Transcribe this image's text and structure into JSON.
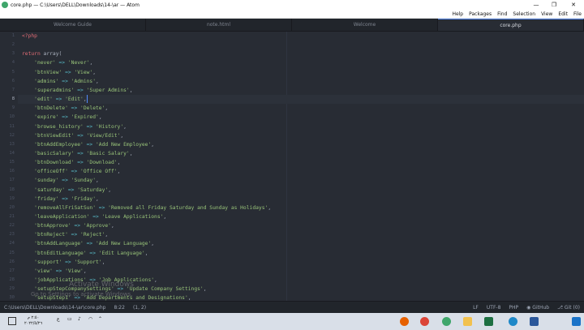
{
  "window": {
    "title": "core.php — C:\\Users\\DELL\\Downloads\\14-\\ar — Atom",
    "minimize": "—",
    "maximize": "❐",
    "close": "✕"
  },
  "menu": [
    "Help",
    "Packages",
    "Find",
    "Selection",
    "View",
    "Edit",
    "File"
  ],
  "tabs": [
    "Welcome Guide",
    "note.html",
    "Welcome",
    "core.php"
  ],
  "editor": {
    "current_line": 8,
    "lines": [
      {
        "n": "1",
        "parts": [
          {
            "c": "k",
            "t": "<?php"
          }
        ]
      },
      {
        "n": "2",
        "parts": []
      },
      {
        "n": "3",
        "parts": [
          {
            "c": "k",
            "t": "return"
          },
          {
            "c": "",
            "t": " array("
          }
        ]
      },
      {
        "n": "4",
        "parts": [
          {
            "c": "",
            "t": "    "
          },
          {
            "c": "s",
            "t": "'never'"
          },
          {
            "c": "o",
            "t": " => "
          },
          {
            "c": "s",
            "t": "'Never'"
          },
          {
            "c": "",
            "t": ","
          }
        ]
      },
      {
        "n": "5",
        "parts": [
          {
            "c": "",
            "t": "    "
          },
          {
            "c": "s",
            "t": "'btnView'"
          },
          {
            "c": "o",
            "t": " => "
          },
          {
            "c": "s",
            "t": "'View'"
          },
          {
            "c": "",
            "t": ","
          }
        ]
      },
      {
        "n": "6",
        "parts": [
          {
            "c": "",
            "t": "    "
          },
          {
            "c": "s",
            "t": "'admins'"
          },
          {
            "c": "o",
            "t": " => "
          },
          {
            "c": "s",
            "t": "'Admins'"
          },
          {
            "c": "",
            "t": ","
          }
        ]
      },
      {
        "n": "7",
        "parts": [
          {
            "c": "",
            "t": "    "
          },
          {
            "c": "s",
            "t": "'superadmins'"
          },
          {
            "c": "o",
            "t": " => "
          },
          {
            "c": "s",
            "t": "'Super Admins'"
          },
          {
            "c": "",
            "t": ","
          }
        ]
      },
      {
        "n": "8",
        "parts": [
          {
            "c": "",
            "t": "    "
          },
          {
            "c": "s",
            "t": "'edit'"
          },
          {
            "c": "o",
            "t": " => "
          },
          {
            "c": "s",
            "t": "'Edit'"
          },
          {
            "c": "",
            "t": ","
          }
        ]
      },
      {
        "n": "9",
        "parts": [
          {
            "c": "",
            "t": "    "
          },
          {
            "c": "s",
            "t": "'btnDelete'"
          },
          {
            "c": "o",
            "t": " => "
          },
          {
            "c": "s",
            "t": "'Delete'"
          },
          {
            "c": "",
            "t": ","
          }
        ]
      },
      {
        "n": "10",
        "parts": [
          {
            "c": "",
            "t": "    "
          },
          {
            "c": "s",
            "t": "'expire'"
          },
          {
            "c": "o",
            "t": " => "
          },
          {
            "c": "s",
            "t": "'Expired'"
          },
          {
            "c": "",
            "t": ","
          }
        ]
      },
      {
        "n": "11",
        "parts": [
          {
            "c": "",
            "t": "    "
          },
          {
            "c": "s",
            "t": "'browse_history'"
          },
          {
            "c": "o",
            "t": " => "
          },
          {
            "c": "s",
            "t": "'History'"
          },
          {
            "c": "",
            "t": ","
          }
        ]
      },
      {
        "n": "12",
        "parts": [
          {
            "c": "",
            "t": "    "
          },
          {
            "c": "s",
            "t": "'btnViewEdit'"
          },
          {
            "c": "o",
            "t": " => "
          },
          {
            "c": "s",
            "t": "'View/Edit'"
          },
          {
            "c": "",
            "t": ","
          }
        ]
      },
      {
        "n": "13",
        "parts": [
          {
            "c": "",
            "t": "    "
          },
          {
            "c": "s",
            "t": "'btnAddEmployee'"
          },
          {
            "c": "o",
            "t": " => "
          },
          {
            "c": "s",
            "t": "'Add New Employee'"
          },
          {
            "c": "",
            "t": ","
          }
        ]
      },
      {
        "n": "14",
        "parts": [
          {
            "c": "",
            "t": "    "
          },
          {
            "c": "s",
            "t": "'basicSalary'"
          },
          {
            "c": "o",
            "t": " => "
          },
          {
            "c": "s",
            "t": "'Basic Salary'"
          },
          {
            "c": "",
            "t": ","
          }
        ]
      },
      {
        "n": "15",
        "parts": [
          {
            "c": "",
            "t": "    "
          },
          {
            "c": "s",
            "t": "'btnDownload'"
          },
          {
            "c": "o",
            "t": " => "
          },
          {
            "c": "s",
            "t": "'Download'"
          },
          {
            "c": "",
            "t": ","
          }
        ]
      },
      {
        "n": "16",
        "parts": [
          {
            "c": "",
            "t": "    "
          },
          {
            "c": "s",
            "t": "'officeOff'"
          },
          {
            "c": "o",
            "t": " => "
          },
          {
            "c": "s",
            "t": "'Office Off'"
          },
          {
            "c": "",
            "t": ","
          }
        ]
      },
      {
        "n": "17",
        "parts": [
          {
            "c": "",
            "t": "    "
          },
          {
            "c": "s",
            "t": "'sunday'"
          },
          {
            "c": "o",
            "t": " => "
          },
          {
            "c": "s",
            "t": "'Sunday'"
          },
          {
            "c": "",
            "t": ","
          }
        ]
      },
      {
        "n": "18",
        "parts": [
          {
            "c": "",
            "t": "    "
          },
          {
            "c": "s",
            "t": "'saturday'"
          },
          {
            "c": "o",
            "t": " => "
          },
          {
            "c": "s",
            "t": "'Saturday'"
          },
          {
            "c": "",
            "t": ","
          }
        ]
      },
      {
        "n": "19",
        "parts": [
          {
            "c": "",
            "t": "    "
          },
          {
            "c": "s",
            "t": "'friday'"
          },
          {
            "c": "o",
            "t": " => "
          },
          {
            "c": "s",
            "t": "'Friday'"
          },
          {
            "c": "",
            "t": ","
          }
        ]
      },
      {
        "n": "20",
        "parts": [
          {
            "c": "",
            "t": "    "
          },
          {
            "c": "s",
            "t": "'removeAllFriSatSun'"
          },
          {
            "c": "o",
            "t": " => "
          },
          {
            "c": "s",
            "t": "'Removed all Friday Saturday and Sunday as Holidays'"
          },
          {
            "c": "",
            "t": ","
          }
        ]
      },
      {
        "n": "21",
        "parts": [
          {
            "c": "",
            "t": "    "
          },
          {
            "c": "s",
            "t": "'leaveApplication'"
          },
          {
            "c": "o",
            "t": " => "
          },
          {
            "c": "s",
            "t": "'Leave Applications'"
          },
          {
            "c": "",
            "t": ","
          }
        ]
      },
      {
        "n": "22",
        "parts": [
          {
            "c": "",
            "t": "    "
          },
          {
            "c": "s",
            "t": "'btnApprove'"
          },
          {
            "c": "o",
            "t": " => "
          },
          {
            "c": "s",
            "t": "'Approve'"
          },
          {
            "c": "",
            "t": ","
          }
        ]
      },
      {
        "n": "23",
        "parts": [
          {
            "c": "",
            "t": "    "
          },
          {
            "c": "s",
            "t": "'btnReject'"
          },
          {
            "c": "o",
            "t": " => "
          },
          {
            "c": "s",
            "t": "'Reject'"
          },
          {
            "c": "",
            "t": ","
          }
        ]
      },
      {
        "n": "24",
        "parts": [
          {
            "c": "",
            "t": "    "
          },
          {
            "c": "s",
            "t": "'btnAddLanguage'"
          },
          {
            "c": "o",
            "t": " => "
          },
          {
            "c": "s",
            "t": "'Add New Language'"
          },
          {
            "c": "",
            "t": ","
          }
        ]
      },
      {
        "n": "25",
        "parts": [
          {
            "c": "",
            "t": "    "
          },
          {
            "c": "s",
            "t": "'btnEditLanguage'"
          },
          {
            "c": "o",
            "t": " => "
          },
          {
            "c": "s",
            "t": "'Edit Language'"
          },
          {
            "c": "",
            "t": ","
          }
        ]
      },
      {
        "n": "26",
        "parts": [
          {
            "c": "",
            "t": "    "
          },
          {
            "c": "s",
            "t": "'support'"
          },
          {
            "c": "o",
            "t": " => "
          },
          {
            "c": "s",
            "t": "'Support'"
          },
          {
            "c": "",
            "t": ","
          }
        ]
      },
      {
        "n": "27",
        "parts": [
          {
            "c": "",
            "t": "    "
          },
          {
            "c": "s",
            "t": "'view'"
          },
          {
            "c": "o",
            "t": " => "
          },
          {
            "c": "s",
            "t": "'View'"
          },
          {
            "c": "",
            "t": ","
          }
        ]
      },
      {
        "n": "28",
        "parts": [
          {
            "c": "",
            "t": "    "
          },
          {
            "c": "s",
            "t": "'jobApplications'"
          },
          {
            "c": "o",
            "t": " => "
          },
          {
            "c": "s",
            "t": "'Job Applications'"
          },
          {
            "c": "",
            "t": ","
          }
        ]
      },
      {
        "n": "29",
        "parts": [
          {
            "c": "",
            "t": "    "
          },
          {
            "c": "s",
            "t": "'setupStepCompanySettings'"
          },
          {
            "c": "o",
            "t": " => "
          },
          {
            "c": "s",
            "t": "'Update Company Settings'"
          },
          {
            "c": "",
            "t": ","
          }
        ]
      },
      {
        "n": "30",
        "parts": [
          {
            "c": "",
            "t": "    "
          },
          {
            "c": "s",
            "t": "'setupStep1'"
          },
          {
            "c": "o",
            "t": " => "
          },
          {
            "c": "s",
            "t": "'Add Departments and Designations'"
          },
          {
            "c": "",
            "t": ","
          }
        ]
      }
    ]
  },
  "watermark": {
    "line1": "Activate Windows",
    "line2": "Go to Settings to activate Windows."
  },
  "status": {
    "path": "C:\\Users\\DELL\\Downloads\\14-\\ar\\core.php",
    "cursor": "8:22",
    "selection": "(1, 2)",
    "line_ending": "LF",
    "encoding": "UTF-8",
    "grammar": "PHP",
    "github": "GitHub",
    "git": "Git (0)"
  },
  "taskbar": {
    "time": "٢:٥٠ م",
    "date": "٢٠٢٢/٥/٢٦",
    "apps": [
      {
        "name": "firefox-icon",
        "color": "#e66000"
      },
      {
        "name": "chrome-icon",
        "color": "#db4437"
      },
      {
        "name": "atom-icon",
        "color": "#3fa66b"
      },
      {
        "name": "file-explorer-icon",
        "color": "#f2c14e"
      },
      {
        "name": "excel-icon",
        "color": "#1d6f42"
      },
      {
        "name": "edge-icon",
        "color": "#1e88c8"
      },
      {
        "name": "word-icon",
        "color": "#2b579a"
      },
      {
        "name": "start-icon",
        "color": "#1a73c8"
      }
    ]
  }
}
